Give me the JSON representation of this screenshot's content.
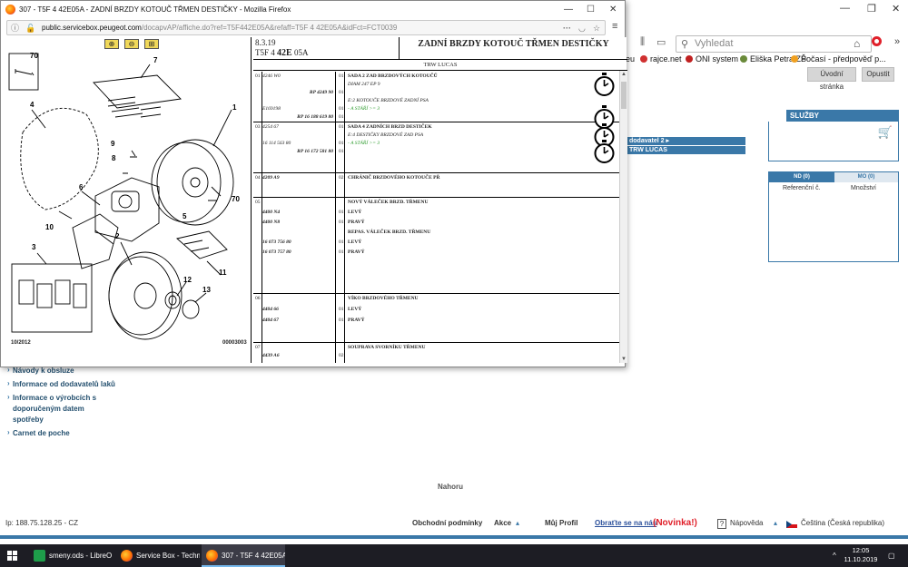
{
  "bg_browser": {
    "search_placeholder": "Vyhledat",
    "bookmark_partial": "eu",
    "bookmarks": [
      "rajce.net",
      "ONI system",
      "Eliška Petra ZŠ",
      "Počasí - předpověď p..."
    ],
    "btn_home": "Úvodní stránka",
    "btn_exit": "Opustit",
    "sluzby": "SLUŽBY",
    "blue_bar_1": "dodavatel 2 ▸",
    "blue_bar_2": "TRW LUCAS",
    "tab_nd": "ND (0)",
    "tab_mo": "MO (0)",
    "col_ref": "Referenční č.",
    "col_qty": "Množství",
    "left_links": [
      "Návody k obsluze",
      "Informace od dodavatelů laků",
      "Informace o výrobcích s doporučeným datem spotřeby",
      "Carnet de poche"
    ],
    "nahoru": "Nahoru",
    "footer": {
      "ip": "Ip: 188.75.128.25 - CZ",
      "terms": "Obchodní podmínky",
      "akce": "Akce",
      "profile": "Můj Profil",
      "contact": "Obraťte se na nás",
      "novinka": "(Novinka!)",
      "help": "Nápověda",
      "language": "Čeština (Česká republika)"
    }
  },
  "popup": {
    "window_title": "307 - T5F 4 42E05A - ZADNÍ BRZDY KOTOUČ TŘMEN DESTIČKY - Mozilla Firefox",
    "url_host": "public.servicebox.peugeot.com",
    "url_path": "/docapvAP/affiche.do?ref=T5F442E05A&refaff=T5F 4 42E05A&idFct=FCT0039",
    "illustration": {
      "date": "10/2012",
      "code": "00003003",
      "badge": "70",
      "callouts": [
        "1",
        "2",
        "3",
        "4",
        "5",
        "6",
        "7",
        "8",
        "9",
        "10",
        "11",
        "12",
        "13",
        "70"
      ]
    },
    "doc": {
      "code_line1": "8.3.19",
      "code_prefix": "T5F 4",
      "code_bold": "42E",
      "code_suffix": "05A",
      "title": "ZADNÍ BRZDY KOTOUČ TŘMEN DESTIČKY",
      "manufacturer": "TRW LUCAS",
      "rows": [
        {
          "grp": "01",
          "lines": [
            {
              "ref": "4246 W0",
              "rp": "",
              "qty": "01",
              "desc": "SADA 2 ZAD BRZDOVÝCH KOTOUČŮ",
              "kind": "desc"
            },
            {
              "ref": "",
              "rp": "",
              "qty": "",
              "desc": "DIAM 247 EP 9",
              "kind": "sub"
            },
            {
              "ref": "",
              "rp": "RP 4249 90",
              "qty": "01",
              "desc": "",
              "kind": "sub"
            },
            {
              "ref": "",
              "rp": "",
              "qty": "",
              "desc": "E:2 KOTOUČE BRZDOVÉ ZADNÍ PSA",
              "kind": "sub"
            },
            {
              "ref": "E169198",
              "rp": "",
              "qty": "01",
              "desc": "- A STÁŘÍ >= 3",
              "kind": "green"
            },
            {
              "ref": "",
              "rp": "RP 16 188 619 80",
              "qty": "01",
              "desc": "",
              "kind": "sub"
            }
          ]
        },
        {
          "grp": "03",
          "lines": [
            {
              "ref": "4254 67",
              "rp": "",
              "qty": "01",
              "desc": "SADA 4 ZADNÍCH BRZD DESTIČEK",
              "kind": "desc"
            },
            {
              "ref": "",
              "rp": "",
              "qty": "",
              "desc": "E:4 DESTIČKY BRZDOVÉ ZAD PSA",
              "kind": "sub"
            },
            {
              "ref": "16 114 563 80",
              "rp": "",
              "qty": "01",
              "desc": "- A STÁŘÍ >= 3",
              "kind": "green"
            },
            {
              "ref": "",
              "rp": "RP 16 172 581 80",
              "qty": "01",
              "desc": "",
              "kind": "sub"
            }
          ]
        },
        {
          "grp": "04",
          "lines": [
            {
              "ref": "4209 A9",
              "rp": "",
              "qty": "02",
              "desc": "CHRÁNIČ BRZDOVÉHO KOTOUČE PŘ",
              "kind": "desc"
            }
          ]
        },
        {
          "grp": "05",
          "lines": [
            {
              "ref": "",
              "rp": "",
              "qty": "",
              "desc": "NOVÝ VÁLEČEK BRZD. TŘMENU",
              "kind": "desc"
            },
            {
              "ref": "4400 N4",
              "rp": "",
              "qty": "01",
              "desc": "LEVÝ",
              "kind": "desc"
            },
            {
              "ref": "4400 N8",
              "rp": "",
              "qty": "01",
              "desc": "PRAVÝ",
              "kind": "desc"
            },
            {
              "ref": "",
              "rp": "",
              "qty": "",
              "desc": "REPAS. VÁLEČEK BRZD. TŘMENU",
              "kind": "desc"
            },
            {
              "ref": "16 073 756 80",
              "rp": "",
              "qty": "01",
              "desc": "LEVÝ",
              "kind": "desc"
            },
            {
              "ref": "16 073 757 80",
              "rp": "",
              "qty": "01",
              "desc": "PRAVÝ",
              "kind": "desc"
            }
          ]
        },
        {
          "grp": "06",
          "lines": [
            {
              "ref": "",
              "rp": "",
              "qty": "",
              "desc": "VÍKO BRZDOVÉHO TŘMENU",
              "kind": "desc"
            },
            {
              "ref": "4404 66",
              "rp": "",
              "qty": "01",
              "desc": "LEVÝ",
              "kind": "desc"
            },
            {
              "ref": "4404 67",
              "rp": "",
              "qty": "01",
              "desc": "PRAVÝ",
              "kind": "desc"
            }
          ]
        },
        {
          "grp": "07",
          "lines": [
            {
              "ref": "",
              "rp": "",
              "qty": "",
              "desc": "SOUPRAVA SVORNÍKU TŘMENU",
              "kind": "desc"
            },
            {
              "ref": "4439 A6",
              "rp": "",
              "qty": "02",
              "desc": "",
              "kind": "desc"
            }
          ]
        }
      ]
    }
  },
  "taskbar": {
    "tasks": [
      "smeny.ods - LibreO...",
      "Service Box - Techn...",
      "307 - T5F 4 42E05A ..."
    ],
    "time": "12:05",
    "date": "11.10.2019"
  },
  "colors": {
    "accent": "#3a78a8",
    "taskbar": "#1d1d24",
    "green_note": "#2a9a2a"
  }
}
